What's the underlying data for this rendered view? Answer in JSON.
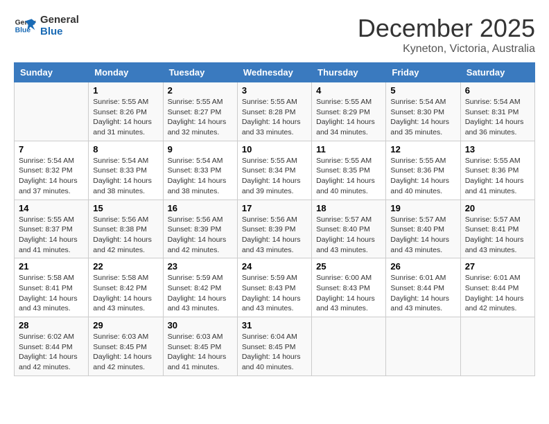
{
  "header": {
    "logo_line1": "General",
    "logo_line2": "Blue",
    "month": "December 2025",
    "location": "Kyneton, Victoria, Australia"
  },
  "weekdays": [
    "Sunday",
    "Monday",
    "Tuesday",
    "Wednesday",
    "Thursday",
    "Friday",
    "Saturday"
  ],
  "weeks": [
    [
      {
        "day": "",
        "info": ""
      },
      {
        "day": "1",
        "info": "Sunrise: 5:55 AM\nSunset: 8:26 PM\nDaylight: 14 hours\nand 31 minutes."
      },
      {
        "day": "2",
        "info": "Sunrise: 5:55 AM\nSunset: 8:27 PM\nDaylight: 14 hours\nand 32 minutes."
      },
      {
        "day": "3",
        "info": "Sunrise: 5:55 AM\nSunset: 8:28 PM\nDaylight: 14 hours\nand 33 minutes."
      },
      {
        "day": "4",
        "info": "Sunrise: 5:55 AM\nSunset: 8:29 PM\nDaylight: 14 hours\nand 34 minutes."
      },
      {
        "day": "5",
        "info": "Sunrise: 5:54 AM\nSunset: 8:30 PM\nDaylight: 14 hours\nand 35 minutes."
      },
      {
        "day": "6",
        "info": "Sunrise: 5:54 AM\nSunset: 8:31 PM\nDaylight: 14 hours\nand 36 minutes."
      }
    ],
    [
      {
        "day": "7",
        "info": "Sunrise: 5:54 AM\nSunset: 8:32 PM\nDaylight: 14 hours\nand 37 minutes."
      },
      {
        "day": "8",
        "info": "Sunrise: 5:54 AM\nSunset: 8:33 PM\nDaylight: 14 hours\nand 38 minutes."
      },
      {
        "day": "9",
        "info": "Sunrise: 5:54 AM\nSunset: 8:33 PM\nDaylight: 14 hours\nand 38 minutes."
      },
      {
        "day": "10",
        "info": "Sunrise: 5:55 AM\nSunset: 8:34 PM\nDaylight: 14 hours\nand 39 minutes."
      },
      {
        "day": "11",
        "info": "Sunrise: 5:55 AM\nSunset: 8:35 PM\nDaylight: 14 hours\nand 40 minutes."
      },
      {
        "day": "12",
        "info": "Sunrise: 5:55 AM\nSunset: 8:36 PM\nDaylight: 14 hours\nand 40 minutes."
      },
      {
        "day": "13",
        "info": "Sunrise: 5:55 AM\nSunset: 8:36 PM\nDaylight: 14 hours\nand 41 minutes."
      }
    ],
    [
      {
        "day": "14",
        "info": "Sunrise: 5:55 AM\nSunset: 8:37 PM\nDaylight: 14 hours\nand 41 minutes."
      },
      {
        "day": "15",
        "info": "Sunrise: 5:56 AM\nSunset: 8:38 PM\nDaylight: 14 hours\nand 42 minutes."
      },
      {
        "day": "16",
        "info": "Sunrise: 5:56 AM\nSunset: 8:39 PM\nDaylight: 14 hours\nand 42 minutes."
      },
      {
        "day": "17",
        "info": "Sunrise: 5:56 AM\nSunset: 8:39 PM\nDaylight: 14 hours\nand 43 minutes."
      },
      {
        "day": "18",
        "info": "Sunrise: 5:57 AM\nSunset: 8:40 PM\nDaylight: 14 hours\nand 43 minutes."
      },
      {
        "day": "19",
        "info": "Sunrise: 5:57 AM\nSunset: 8:40 PM\nDaylight: 14 hours\nand 43 minutes."
      },
      {
        "day": "20",
        "info": "Sunrise: 5:57 AM\nSunset: 8:41 PM\nDaylight: 14 hours\nand 43 minutes."
      }
    ],
    [
      {
        "day": "21",
        "info": "Sunrise: 5:58 AM\nSunset: 8:41 PM\nDaylight: 14 hours\nand 43 minutes."
      },
      {
        "day": "22",
        "info": "Sunrise: 5:58 AM\nSunset: 8:42 PM\nDaylight: 14 hours\nand 43 minutes."
      },
      {
        "day": "23",
        "info": "Sunrise: 5:59 AM\nSunset: 8:42 PM\nDaylight: 14 hours\nand 43 minutes."
      },
      {
        "day": "24",
        "info": "Sunrise: 5:59 AM\nSunset: 8:43 PM\nDaylight: 14 hours\nand 43 minutes."
      },
      {
        "day": "25",
        "info": "Sunrise: 6:00 AM\nSunset: 8:43 PM\nDaylight: 14 hours\nand 43 minutes."
      },
      {
        "day": "26",
        "info": "Sunrise: 6:01 AM\nSunset: 8:44 PM\nDaylight: 14 hours\nand 43 minutes."
      },
      {
        "day": "27",
        "info": "Sunrise: 6:01 AM\nSunset: 8:44 PM\nDaylight: 14 hours\nand 42 minutes."
      }
    ],
    [
      {
        "day": "28",
        "info": "Sunrise: 6:02 AM\nSunset: 8:44 PM\nDaylight: 14 hours\nand 42 minutes."
      },
      {
        "day": "29",
        "info": "Sunrise: 6:03 AM\nSunset: 8:45 PM\nDaylight: 14 hours\nand 42 minutes."
      },
      {
        "day": "30",
        "info": "Sunrise: 6:03 AM\nSunset: 8:45 PM\nDaylight: 14 hours\nand 41 minutes."
      },
      {
        "day": "31",
        "info": "Sunrise: 6:04 AM\nSunset: 8:45 PM\nDaylight: 14 hours\nand 40 minutes."
      },
      {
        "day": "",
        "info": ""
      },
      {
        "day": "",
        "info": ""
      },
      {
        "day": "",
        "info": ""
      }
    ]
  ]
}
